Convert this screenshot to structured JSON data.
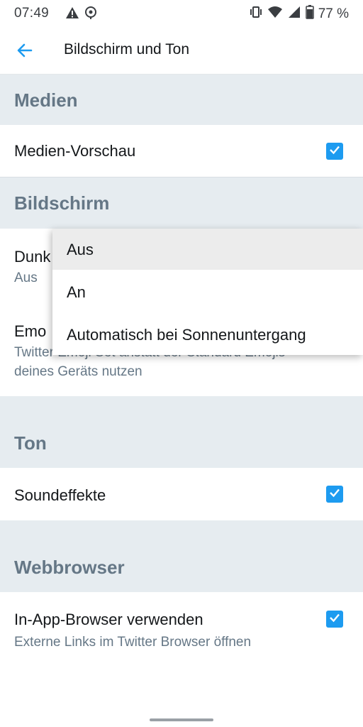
{
  "status_bar": {
    "time": "07:49",
    "battery": "77 %",
    "left_icons": [
      "warning-icon",
      "location-icon"
    ],
    "right_icons": [
      "vibrate-icon",
      "wifi-icon",
      "signal-icon",
      "battery-icon"
    ]
  },
  "header": {
    "title": "Bildschirm und Ton"
  },
  "sections": {
    "medien": {
      "title": "Medien",
      "media_preview": {
        "label": "Medien-Vorschau",
        "checked": true
      }
    },
    "bildschirm": {
      "title": "Bildschirm",
      "dark_mode": {
        "label": "Dunk",
        "value": "Aus"
      },
      "emoji": {
        "label": "Emo",
        "sub_line1": "Twitter Emoji Set anstatt der Standard Emojis",
        "sub_line2": "deines Geräts nutzen"
      }
    },
    "ton": {
      "title": "Ton",
      "sound_effects": {
        "label": "Soundeffekte",
        "checked": true
      }
    },
    "webbrowser": {
      "title": "Webbrowser",
      "in_app_browser": {
        "label": "In-App-Browser verwenden",
        "sub": "Externe Links im Twitter Browser öffnen",
        "checked": true
      }
    }
  },
  "dropdown": {
    "options": [
      "Aus",
      "An",
      "Automatisch bei Sonnenuntergang"
    ],
    "selected": "Aus"
  },
  "colors": {
    "accent": "#1d9bf0",
    "section_bg": "#e6ecf0",
    "section_text": "#657786"
  }
}
